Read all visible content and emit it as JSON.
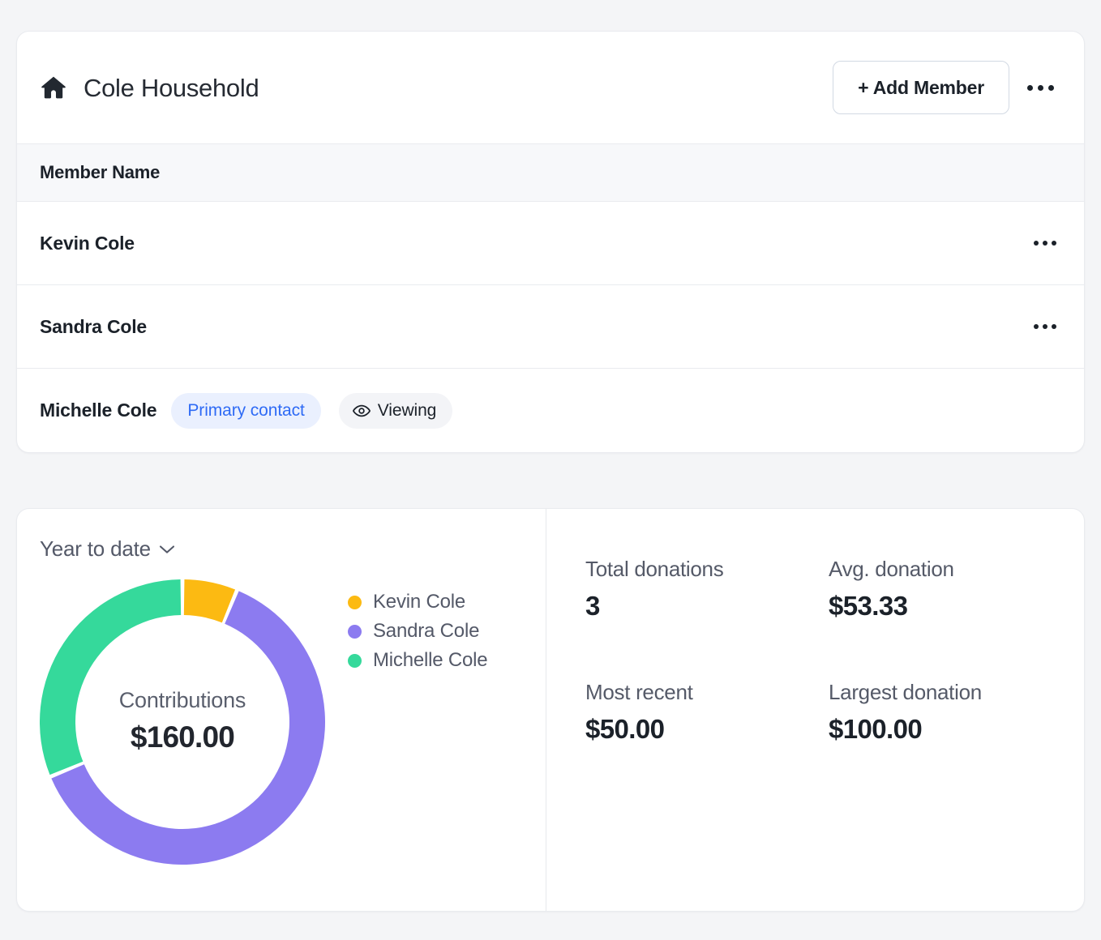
{
  "household": {
    "title": "Cole Household",
    "home_icon": "home-icon",
    "add_member_label": "+ Add Member",
    "overflow_icon": "ellipsis-icon",
    "table": {
      "column_header": "Member Name",
      "rows": [
        {
          "name": "Kevin Cole",
          "badges": [],
          "overflow_icon": "ellipsis-icon"
        },
        {
          "name": "Sandra Cole",
          "badges": [],
          "overflow_icon": "ellipsis-icon"
        },
        {
          "name": "Michelle Cole",
          "badges": [
            {
              "label": "Primary contact",
              "style": "primary"
            },
            {
              "label": "Viewing",
              "style": "viewing",
              "icon": "eye-icon"
            }
          ],
          "overflow_icon": null
        }
      ]
    }
  },
  "summary": {
    "period_label": "Year to date",
    "period_chevron_icon": "chevron-down-icon",
    "donut_center_label": "Contributions",
    "donut_center_value": "$160.00",
    "stats": [
      {
        "label": "Total donations",
        "value": "3"
      },
      {
        "label": "Avg. donation",
        "value": "$53.33"
      },
      {
        "label": "Most recent",
        "value": "$50.00"
      },
      {
        "label": "Largest donation",
        "value": "$100.00"
      }
    ]
  },
  "colors": {
    "kevin": "#FCBA12",
    "sandra": "#8C7BF0",
    "michelle": "#35D99B",
    "badge_primary_bg": "#EAF0FE",
    "badge_primary_text": "#2F6BF5",
    "badge_viewing_bg": "#F3F4F7",
    "page_bg": "#F4F5F7",
    "card_bg": "#FFFFFF"
  },
  "chart_data": {
    "type": "pie",
    "title": "Contributions",
    "total": 160,
    "total_formatted": "$160.00",
    "categories": [
      "Kevin Cole",
      "Sandra Cole",
      "Michelle Cole"
    ],
    "values": [
      10,
      100,
      50
    ],
    "percentages": [
      6.25,
      62.5,
      31.25
    ],
    "colors": [
      "#FCBA12",
      "#8C7BF0",
      "#35D99B"
    ],
    "legend": [
      "Kevin Cole",
      "Sandra Cole",
      "Michelle Cole"
    ],
    "legend_position": "right",
    "donut": true,
    "start_angle_deg": 0,
    "direction": "clockwise",
    "xlabel": "",
    "ylabel": ""
  }
}
